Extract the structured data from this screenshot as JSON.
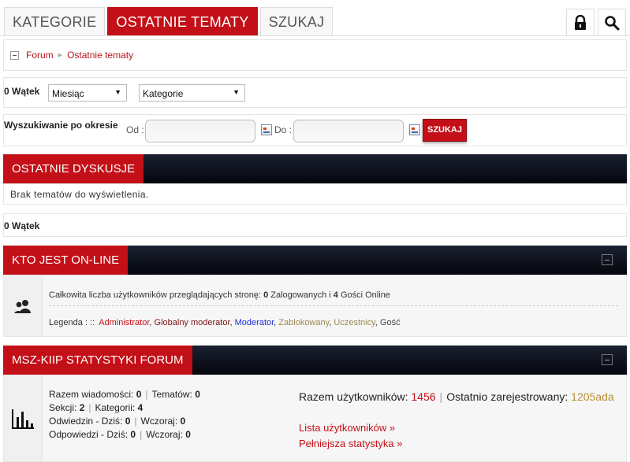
{
  "tabs": [
    "KATEGORIE",
    "OSTATNIE TEMATY",
    "SZUKAJ"
  ],
  "breadcrumb": {
    "items": [
      "Forum",
      "Ostatnie tematy"
    ]
  },
  "filters": {
    "thread_count": "0 Wątek",
    "month_select": "Miesiąc",
    "category_select": "Kategorie"
  },
  "date_search": {
    "label": "Wyszukiwanie po okresie",
    "from_label": "Od :",
    "to_label": "Do :",
    "button": "SZUKAJ"
  },
  "recent": {
    "title": "OSTATNIE DYSKUSJE",
    "empty_message": "Brak tematów do wyświetlenia.",
    "thread_count": "0 Wątek"
  },
  "online": {
    "title": "KTO JEST ON-LINE",
    "summary_pre": "Całkowita liczba użytkowników przeglądających stronę:",
    "logged_count": "0",
    "logged_label": "Zalogowanych i",
    "guest_count": "4",
    "guest_label": "Gości Online",
    "legend_label": "Legenda :",
    "legend_sep": "::",
    "legend": [
      {
        "name": "Administrator",
        "color": "#c30f17"
      },
      {
        "name": "Globalny moderator",
        "color": "#7a1010"
      },
      {
        "name": "Moderator",
        "color": "#1a2fd6"
      },
      {
        "name": "Zablokowany",
        "color": "#9a8a50"
      },
      {
        "name": "Uczestnicy",
        "color": "#9a8a50"
      },
      {
        "name": "Gość",
        "color": "#444444"
      }
    ]
  },
  "stats": {
    "title": "MSZ-KIIP STATYSTYKI FORUM",
    "messages_label": "Razem wiadomości:",
    "messages": "0",
    "topics_label": "Tematów:",
    "topics": "0",
    "sections_label": "Sekcji:",
    "sections": "2",
    "categories_label": "Kategorii:",
    "categories": "4",
    "visits_label": "Odwiedzin - Dziś:",
    "visits_today": "0",
    "visits_yesterday_label": "Wczoraj:",
    "visits_yesterday": "0",
    "replies_label": "Odpowiedzi - Dziś:",
    "replies_today": "0",
    "replies_yesterday_label": "Wczoraj:",
    "replies_yesterday": "0",
    "users_label": "Razem użytkowników:",
    "users": "1456",
    "latest_label": "Ostatnio zarejestrowany:",
    "latest_user": "1205ada",
    "user_list_link": "Lista użytkowników »",
    "full_stats_link": "Pełniejsza statystyka »"
  },
  "colors": {
    "accent": "#c30f17",
    "header_dark": "#05070e",
    "latest_user": "#b8903a"
  }
}
